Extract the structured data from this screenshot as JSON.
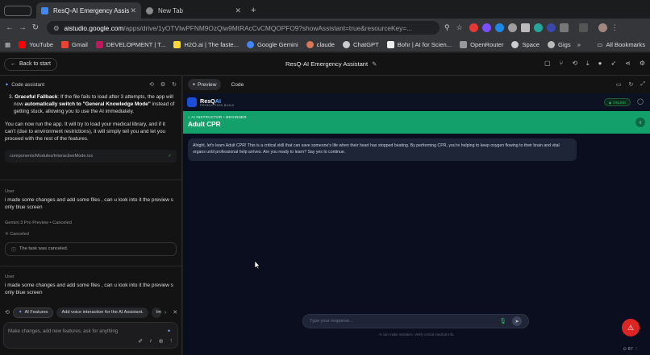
{
  "browser": {
    "tabs": [
      {
        "title": "ResQ-AI Emergency Assis",
        "active": true
      },
      {
        "title": "New Tab",
        "active": false
      }
    ],
    "new_tab_symbol": "+",
    "url_site": "aistudio.google.com",
    "url_path": "/apps/drive/1yOTVIwPFNM9OzQiw9MtRAcCvCMQOPFO9?showAssistant=true&resourceKey=..."
  },
  "bookmarks": {
    "items": [
      "YouTube",
      "Gmail",
      "DEVELOPMENT | T...",
      "H2O.ai | The faste...",
      "Google Gemini",
      "claude",
      "ChatGPT",
      "Bohr | AI for Scien...",
      "OpenRouter",
      "Space",
      "Gigs"
    ],
    "all_label": "All Bookmarks"
  },
  "app": {
    "back_label": "Back to start",
    "title": "ResQ-AI Emergency Assistant"
  },
  "assistant": {
    "header": "Code assistant",
    "msg1_bullet": "3.",
    "msg1_bold": "Graceful Fallback",
    "msg1_a": ": If the file fails to load after 3 attempts, the app will now ",
    "msg1_bold2": "automatically switch to \"General Knowledge Mode\"",
    "msg1_b": " instead of getting stuck, allowing you to use the AI immediately.",
    "msg2": "You can now run the app. It will try to load your medical library, and if it can't (due to environment restrictions), it will simply tell you and let you proceed with the rest of the features.",
    "file": "components/Modules/InteractiveMode.tsx",
    "user_label": "User",
    "user_msg": "i made some changes and add some files , can u look into it the preview s only blue screen",
    "model_label": "Gemini 3 Pro Preview",
    "model_status": "Canceled",
    "canceled": "Canceled",
    "canceled_note": "The task was canceled.",
    "user_label2": "User",
    "user_msg2": "i made some changes and add some files , can u look into it the preview s only blue screen",
    "suggestions": [
      "AI Features",
      "Add voice interaction for the AI Assistant.",
      "Imp"
    ],
    "compose_placeholder": "Make changes, add new features, ask for anything"
  },
  "preview": {
    "tab_preview": "Preview",
    "tab_code": "Code",
    "brand_a": "ResQ",
    "brand_b": "AI",
    "brand_sub": "PRODUCTION BUILD",
    "status": "ONLINE",
    "mode": "AI INSTRUCTOR • BEGINNER",
    "topic": "Adult CPR",
    "message": "Alright, let's learn Adult CPR! This is a critical skill that can save someone's life when their heart has stopped beating. By performing CPR, you're helping to keep oxygen flowing to their brain and vital organs until professional help arrives. Are you ready to learn? Say yes to continue.",
    "input_placeholder": "Type your response...",
    "disclaimer": "AI can make mistakes. Verify critical medical info.",
    "zoom": "87"
  },
  "colors": {
    "accent_green": "#14a06a",
    "sos_red": "#dc2626",
    "preview_bg": "#0a0e1e"
  }
}
